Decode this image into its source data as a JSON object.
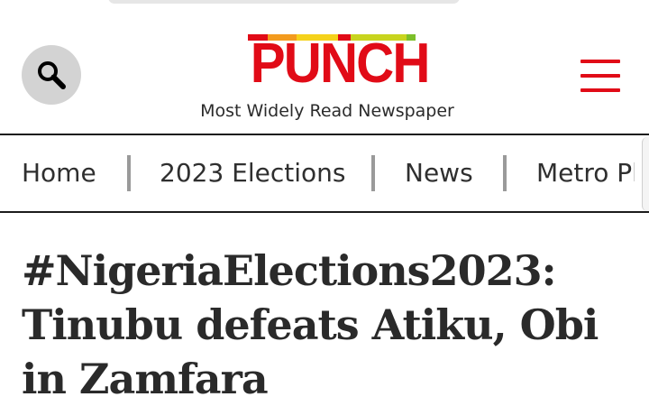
{
  "header": {
    "search_icon": "search-icon",
    "logo_text": "PUNCH",
    "logo_bar_colors": [
      "#e10b17",
      "#f39b1e",
      "#f5d21b",
      "#e10b17",
      "#c8d41e",
      "#7cbf2a"
    ],
    "tagline": "Most Widely Read Newspaper",
    "menu_icon": "hamburger-menu-icon",
    "brand_color": "#e10b17"
  },
  "nav": {
    "items": [
      {
        "label": "Home"
      },
      {
        "label": "2023 Elections"
      },
      {
        "label": "News"
      },
      {
        "label": "Metro Plus"
      }
    ]
  },
  "article": {
    "headline": "#NigeriaElections2023: Tinubu defeats Atiku, Obi in Zamfara"
  }
}
